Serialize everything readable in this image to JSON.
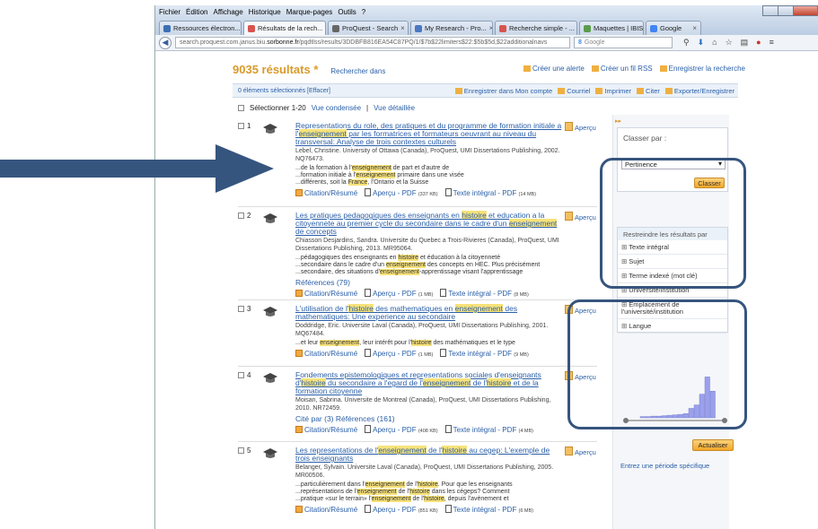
{
  "menu": [
    "Fichier",
    "Édition",
    "Affichage",
    "Historique",
    "Marque-pages",
    "Outils",
    "?"
  ],
  "tabs": [
    {
      "label": "Ressources électron...",
      "icon_color": "#3b6fb5",
      "active": false
    },
    {
      "label": "Résultats de la rech...",
      "icon_color": "#d9534f",
      "active": true
    },
    {
      "label": "ProQuest - Search",
      "icon_color": "#666666",
      "active": false
    },
    {
      "label": "My Research - Pro...",
      "icon_color": "#4a78c2",
      "active": false
    },
    {
      "label": "Recherche simple - ...",
      "icon_color": "#d9534f",
      "active": false
    },
    {
      "label": "Maquettes | IBIS",
      "icon_color": "#5a9c4a",
      "active": false
    },
    {
      "label": "Google",
      "icon_color": "#4285f4",
      "active": false
    }
  ],
  "url": {
    "prefix": "search.proquest.com.janus.biu.",
    "domain": "sorbonne.fr",
    "path": "/pqdtlss/results/3DDBFB816EA54C87PQ/1/$7b$22limiters$22:$5b$5d,$22additionalnavs"
  },
  "search_engine": "Google",
  "header": {
    "count": "9035 résultats *",
    "search_within": "Rechercher dans",
    "actions": [
      "Créer une alerte",
      "Créer un fil RSS",
      "Enregistrer la recherche"
    ]
  },
  "selbar": {
    "selected": "0 éléments sélectionnés [Effacer]",
    "actions": [
      "Enregistrer dans Mon compte",
      "Courriel",
      "Imprimer",
      "Citer",
      "Exporter/Enregistrer"
    ]
  },
  "selectrow": {
    "label": "Sélectionner 1-20",
    "condensed": "Vue condensée",
    "sep": "|",
    "detailed": "Vue détaillée"
  },
  "results": [
    {
      "num": "1",
      "title_parts": [
        {
          "t": "Representations du role, des pratiques et du programme de formation initiale a "
        },
        {
          "t": "l'"
        },
        {
          "t": "enseignement",
          "hl": true
        },
        {
          "t": " par les formatrices et formateurs oeuvrant au niveau du transversal: Analyse de trois contextes culturels"
        }
      ],
      "meta": "Lebel, Christine. University of Ottawa (Canada), ProQuest, UMI Dissertations Publishing, 2002. NQ76473.",
      "snippets": [
        [
          {
            "t": "...de la formation à l'"
          },
          {
            "t": "enseignement",
            "hl": true
          },
          {
            "t": " de part et d'autre de"
          }
        ],
        [
          {
            "t": "...formation initiale à l'"
          },
          {
            "t": "enseignement",
            "hl": true
          },
          {
            "t": " primaire dans une visée"
          }
        ],
        [
          {
            "t": "...différents, soit la "
          },
          {
            "t": "France",
            "hl": true
          },
          {
            "t": ", l'Ontario et la Suisse"
          }
        ]
      ],
      "refs": "",
      "links": [
        {
          "label": "Citation/Résumé",
          "size": "",
          "kind": "cite"
        },
        {
          "label": "Aperçu - PDF",
          "size": "(337 KB)",
          "kind": "pdf"
        },
        {
          "label": "Texte intégral - PDF",
          "size": "(14 MB)",
          "kind": "pdf"
        }
      ]
    },
    {
      "num": "2",
      "title_parts": [
        {
          "t": "Les pratiques pedagogiques des enseignants en "
        },
        {
          "t": "histoire",
          "hl": true
        },
        {
          "t": " et education a la citoyennete au premier cycle du secondaire dans le cadre d'un "
        },
        {
          "t": "enseignement",
          "hl": true
        },
        {
          "t": " de concepts"
        }
      ],
      "meta": "Chiasson Desjardins, Sandra. Universite du Quebec a Trois-Rivieres (Canada), ProQuest, UMI Dissertations Publishing, 2013. MR95064.",
      "snippets": [
        [
          {
            "t": "...pédagogiques des enseignants en "
          },
          {
            "t": "histoire",
            "hl": true
          },
          {
            "t": " et éducation à la citoyenneté"
          }
        ],
        [
          {
            "t": "...secondaire dans le cadre d'un "
          },
          {
            "t": "enseignement",
            "hl": true
          },
          {
            "t": " des concepts en HEC. Plus précisément"
          }
        ],
        [
          {
            "t": "...secondaire, des situations d'"
          },
          {
            "t": "enseignement",
            "hl": true
          },
          {
            "t": "-apprentissage visant l'apprentissage"
          }
        ]
      ],
      "refs": "Références (79)",
      "links": [
        {
          "label": "Citation/Résumé",
          "size": "",
          "kind": "cite"
        },
        {
          "label": "Aperçu - PDF",
          "size": "(1 MB)",
          "kind": "pdf"
        },
        {
          "label": "Texte intégral - PDF",
          "size": "(8 MB)",
          "kind": "pdf"
        }
      ]
    },
    {
      "num": "3",
      "title_parts": [
        {
          "t": "L'utilisation de l'"
        },
        {
          "t": "histoire",
          "hl": true
        },
        {
          "t": " des mathematiques en "
        },
        {
          "t": "enseignement",
          "hl": true
        },
        {
          "t": " des mathematiques: Une experience au secondaire"
        }
      ],
      "meta": "Doddridge, Eric. Universite Laval (Canada), ProQuest, UMI Dissertations Publishing, 2001. MQ67484.",
      "snippets": [
        [
          {
            "t": "...et leur "
          },
          {
            "t": "enseignement",
            "hl": true
          },
          {
            "t": ", leur intérêt pour l'"
          },
          {
            "t": "histoire",
            "hl": true
          },
          {
            "t": " des mathématiques et le type"
          }
        ]
      ],
      "refs": "",
      "links": [
        {
          "label": "Citation/Résumé",
          "size": "",
          "kind": "cite"
        },
        {
          "label": "Aperçu - PDF",
          "size": "(1 MB)",
          "kind": "pdf"
        },
        {
          "label": "Texte intégral - PDF",
          "size": "(9 MB)",
          "kind": "pdf"
        }
      ]
    },
    {
      "num": "4",
      "title_parts": [
        {
          "t": "Fondements epistemologiques et representations sociales d'enseignants d'"
        },
        {
          "t": "histoire",
          "hl": true
        },
        {
          "t": " du secondaire a l'egard de l'"
        },
        {
          "t": "enseignement",
          "hl": true
        },
        {
          "t": " de l'"
        },
        {
          "t": "histoire",
          "hl": true
        },
        {
          "t": " et de la formation citoyenne"
        }
      ],
      "meta": "Moisan, Sabrina. Universite de Montreal (Canada), ProQuest, UMI Dissertations Publishing, 2010. NR72459.",
      "snippets": [],
      "refs": "Cité par (3)   Références (161)",
      "links": [
        {
          "label": "Citation/Résumé",
          "size": "",
          "kind": "cite"
        },
        {
          "label": "Aperçu - PDF",
          "size": "(408 KB)",
          "kind": "pdf"
        },
        {
          "label": "Texte intégral - PDF",
          "size": "(4 MB)",
          "kind": "pdf"
        }
      ]
    },
    {
      "num": "5",
      "title_parts": [
        {
          "t": "Les representations de l'"
        },
        {
          "t": "enseignement",
          "hl": true
        },
        {
          "t": " de l'"
        },
        {
          "t": "histoire",
          "hl": true
        },
        {
          "t": " au cegep: L'exemple de trois enseignants"
        }
      ],
      "meta": "Belanger, Sylvain. Universite Laval (Canada), ProQuest, UMI Dissertations Publishing, 2005. MR00506.",
      "snippets": [
        [
          {
            "t": "...particulièrement dans l'"
          },
          {
            "t": "enseignement",
            "hl": true
          },
          {
            "t": " de l'"
          },
          {
            "t": "histoire",
            "hl": true
          },
          {
            "t": ". Pour que les enseignants"
          }
        ],
        [
          {
            "t": "...représentations de l'"
          },
          {
            "t": "enseignement",
            "hl": true
          },
          {
            "t": " de l'"
          },
          {
            "t": "histoire",
            "hl": true
          },
          {
            "t": " dans les cégeps? Comment"
          }
        ],
        [
          {
            "t": "...pratique «sur le terrain» l'"
          },
          {
            "t": "enseignement",
            "hl": true
          },
          {
            "t": " de l'"
          },
          {
            "t": "histoire",
            "hl": true
          },
          {
            "t": ", depuis l'avènement et"
          }
        ]
      ],
      "refs": "",
      "links": [
        {
          "label": "Citation/Résumé",
          "size": "",
          "kind": "cite"
        },
        {
          "label": "Aperçu - PDF",
          "size": "(851 KB)",
          "kind": "pdf"
        },
        {
          "label": "Texte intégral - PDF",
          "size": "(6 MB)",
          "kind": "pdf"
        }
      ]
    }
  ],
  "apercu_label": "Aperçu",
  "sidebar": {
    "sort_title": "Classer par :",
    "sort_value": "Pertinence",
    "sort_button": "Classer",
    "restrict_title": "Restreindre les résultats par",
    "facets": [
      "Texte intégral",
      "Sujet",
      "Terme indexé (mot clé)",
      "Université/institution",
      "Emplacement de l'université/institution",
      "Langue"
    ],
    "date_bars": [
      0.03,
      0.03,
      0.04,
      0.04,
      0.05,
      0.06,
      0.07,
      0.08,
      0.1,
      0.22,
      0.3,
      0.55,
      0.95,
      0.62
    ],
    "update_button": "Actualiser",
    "period_link": "Entrez une période spécifique"
  },
  "colors": {
    "accent": "#d99a2b",
    "link": "#2a5fa8",
    "highlight": "#f7e27a",
    "annotation": "#36557e"
  }
}
